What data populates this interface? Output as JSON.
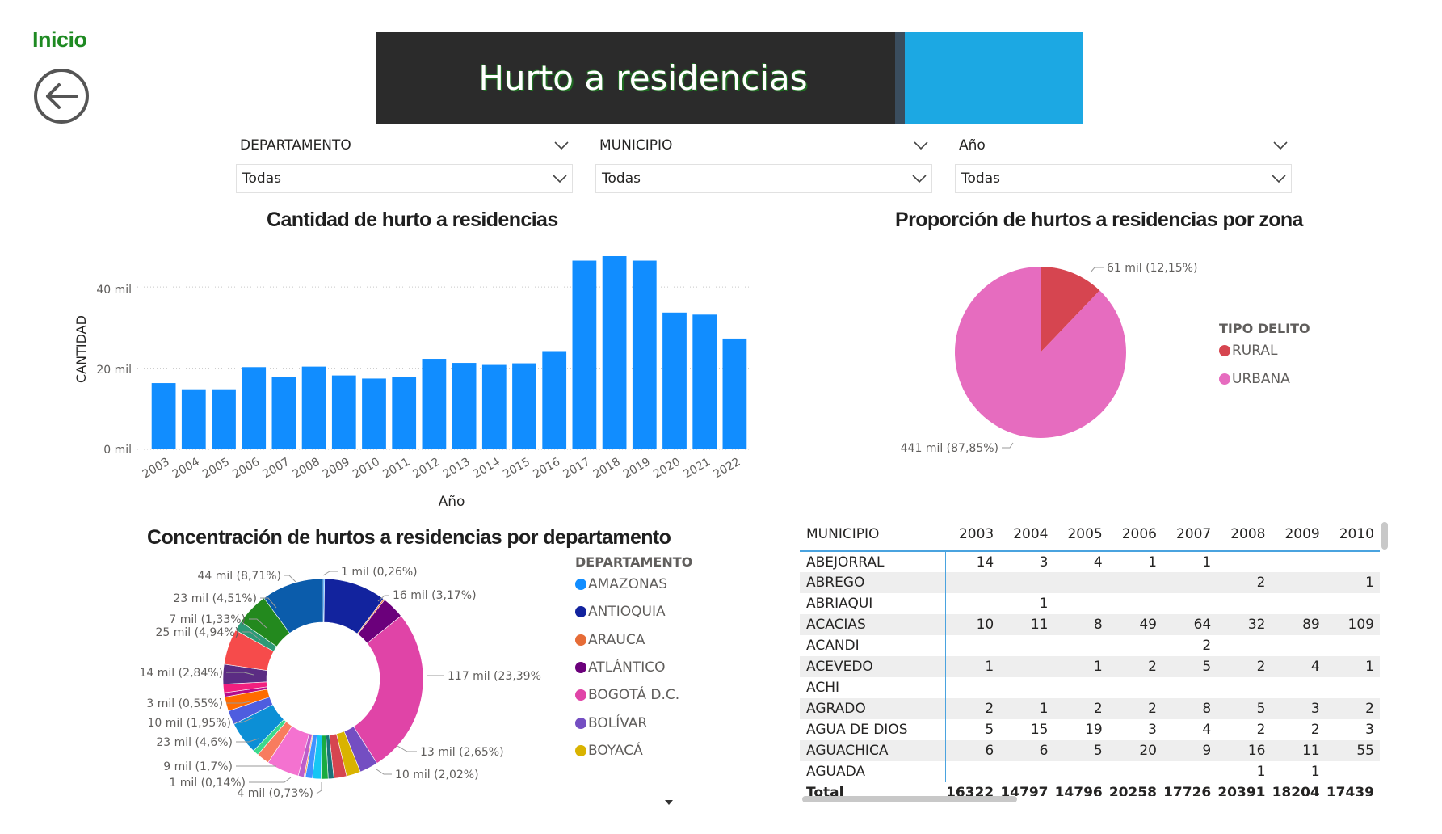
{
  "nav": {
    "home_label": "Inicio",
    "back_icon": "arrow-left-circle-icon"
  },
  "header": {
    "title": "Hurto a residencias"
  },
  "filters": [
    {
      "label": "DEPARTAMENTO",
      "value": "Todas"
    },
    {
      "label": "MUNICIPIO",
      "value": "Todas"
    },
    {
      "label": "Año",
      "value": "Todas"
    }
  ],
  "bar_chart": {
    "title": "Cantidad de hurto a residencias",
    "y_ticks": [
      "40 mil",
      "20 mil",
      "0 mil"
    ]
  },
  "pie_chart": {
    "title": "Proporción de hurtos a residencias por zona",
    "legend_title": "TIPO DELITO",
    "labels": [
      "61 mil (12,15%)",
      "441 mil (87,85%)"
    ]
  },
  "donut_chart": {
    "title": "Concentración de hurtos a residencias por departamento",
    "legend_title": "DEPARTAMENTO",
    "labels": [
      "1 mil (0,26%)",
      "16 mil (3,17%)",
      "117 mil (23,39%)",
      "13 mil (2,65%)",
      "10 mil (2,02%)",
      "4 mil (0,73%)",
      "1 mil (0,14%)",
      "9 mil (1,7%)",
      "23 mil (4,6%)",
      "10 mil (1,95%)",
      "3 mil (0,55%)",
      "14 mil (2,84%)",
      "25 mil (4,94%)",
      "7 mil (1,33%)",
      "23 mil (4,51%)",
      "44 mil (8,71%)"
    ]
  },
  "chart_data": [
    {
      "type": "bar",
      "title": "Cantidad de hurto a residencias",
      "xlabel": "Año",
      "ylabel": "CANTIDAD",
      "categories": [
        "2003",
        "2004",
        "2005",
        "2006",
        "2007",
        "2008",
        "2009",
        "2010",
        "2011",
        "2012",
        "2013",
        "2014",
        "2015",
        "2016",
        "2017",
        "2018",
        "2019",
        "2020",
        "2021",
        "2022"
      ],
      "values": [
        16322,
        14797,
        14796,
        20258,
        17726,
        20391,
        18204,
        17439,
        17900,
        22300,
        21300,
        20800,
        21200,
        24200,
        46500,
        47600,
        46500,
        33700,
        33200,
        27300
      ],
      "ylim": [
        0,
        48000
      ],
      "color": "#118dff",
      "grid": true
    },
    {
      "type": "pie",
      "title": "Proporción de hurtos a residencias por zona",
      "legend_title": "TIPO DELITO",
      "legend_position": "right",
      "slices": [
        {
          "name": "RURAL",
          "value": 61000,
          "percent": 12.15,
          "color": "#d64550"
        },
        {
          "name": "URBANA",
          "value": 441000,
          "percent": 87.85,
          "color": "#e66cbf"
        }
      ]
    },
    {
      "type": "pie",
      "title": "Concentración de hurtos a residencias por departamento",
      "legend_title": "DEPARTAMENTO",
      "legend_position": "right",
      "legend": [
        {
          "name": "AMAZONAS",
          "color": "#118dff"
        },
        {
          "name": "ANTIOQUIA",
          "color": "#12239e"
        },
        {
          "name": "ARAUCA",
          "color": "#e66c37"
        },
        {
          "name": "ATLÁNTICO",
          "color": "#6b007b"
        },
        {
          "name": "BOGOTÁ D.C.",
          "color": "#e044a7"
        },
        {
          "name": "BOLÍVAR",
          "color": "#744ec2"
        },
        {
          "name": "BOYACÁ",
          "color": "#d9b300"
        }
      ],
      "slices": [
        {
          "value": 1,
          "percent": 0.26,
          "color": "#118dff"
        },
        {
          "value": 44,
          "percent": 8.71,
          "color": "#12239e"
        },
        {
          "value": 1,
          "percent": 0.26,
          "color": "#e66c37"
        },
        {
          "value": 16,
          "percent": 3.17,
          "color": "#6b007b"
        },
        {
          "value": 117,
          "percent": 23.39,
          "color": "#e044a7"
        },
        {
          "value": 13,
          "percent": 2.65,
          "color": "#744ec2"
        },
        {
          "value": 10,
          "percent": 2.02,
          "color": "#d9b300"
        },
        {
          "value": 9,
          "percent": 1.7,
          "color": "#d64550"
        },
        {
          "value": 4,
          "percent": 0.73,
          "color": "#197278"
        },
        {
          "value": 5,
          "percent": 1.0,
          "color": "#1aab40"
        },
        {
          "value": 6,
          "percent": 1.2,
          "color": "#15c6f4"
        },
        {
          "value": 5,
          "percent": 1.0,
          "color": "#4092ff"
        },
        {
          "value": 1,
          "percent": 0.14,
          "color": "#ffa058"
        },
        {
          "value": 4,
          "percent": 0.73,
          "color": "#be5dc9"
        },
        {
          "value": 23,
          "percent": 4.6,
          "color": "#f472d0"
        },
        {
          "value": 9,
          "percent": 1.7,
          "color": "#f87c5e"
        },
        {
          "value": 4,
          "percent": 0.8,
          "color": "#3bd98d"
        },
        {
          "value": 23,
          "percent": 4.6,
          "color": "#0c8fd6"
        },
        {
          "value": 10,
          "percent": 1.95,
          "color": "#4e5ddf"
        },
        {
          "value": 10,
          "percent": 1.95,
          "color": "#ff6b00"
        },
        {
          "value": 3,
          "percent": 0.55,
          "color": "#b40b8c"
        },
        {
          "value": 6,
          "percent": 1.1,
          "color": "#f21f7f"
        },
        {
          "value": 14,
          "percent": 2.84,
          "color": "#5b2c83"
        },
        {
          "value": 25,
          "percent": 4.94,
          "color": "#f64b4b"
        },
        {
          "value": 7,
          "percent": 1.33,
          "color": "#2d9a77"
        },
        {
          "value": 23,
          "percent": 4.51,
          "color": "#23891e"
        },
        {
          "value": 44,
          "percent": 8.71,
          "color": "#0b5cab"
        }
      ]
    },
    {
      "type": "table",
      "columns": [
        "MUNICIPIO",
        "2003",
        "2004",
        "2005",
        "2006",
        "2007",
        "2008",
        "2009",
        "2010"
      ],
      "rows": [
        [
          "ABEJORRAL",
          "14",
          "3",
          "4",
          "1",
          "1",
          "",
          "",
          ""
        ],
        [
          "ABREGO",
          "",
          "",
          "",
          "",
          "",
          "2",
          "",
          "1"
        ],
        [
          "ABRIAQUI",
          "",
          "1",
          "",
          "",
          "",
          "",
          "",
          ""
        ],
        [
          "ACACIAS",
          "10",
          "11",
          "8",
          "49",
          "64",
          "32",
          "89",
          "109"
        ],
        [
          "ACANDI",
          "",
          "",
          "",
          "",
          "2",
          "",
          "",
          ""
        ],
        [
          "ACEVEDO",
          "1",
          "",
          "1",
          "2",
          "5",
          "2",
          "4",
          "1"
        ],
        [
          "ACHI",
          "",
          "",
          "",
          "",
          "",
          "",
          "",
          ""
        ],
        [
          "AGRADO",
          "2",
          "1",
          "2",
          "2",
          "8",
          "5",
          "3",
          "2"
        ],
        [
          "AGUA DE DIOS",
          "5",
          "15",
          "19",
          "3",
          "4",
          "2",
          "2",
          "3"
        ],
        [
          "AGUACHICA",
          "6",
          "6",
          "5",
          "20",
          "9",
          "16",
          "11",
          "55"
        ],
        [
          "AGUADA",
          "",
          "",
          "",
          "",
          "",
          "1",
          "1",
          ""
        ]
      ],
      "total": [
        "Total",
        "16322",
        "14797",
        "14796",
        "20258",
        "17726",
        "20391",
        "18204",
        "17439"
      ]
    }
  ]
}
